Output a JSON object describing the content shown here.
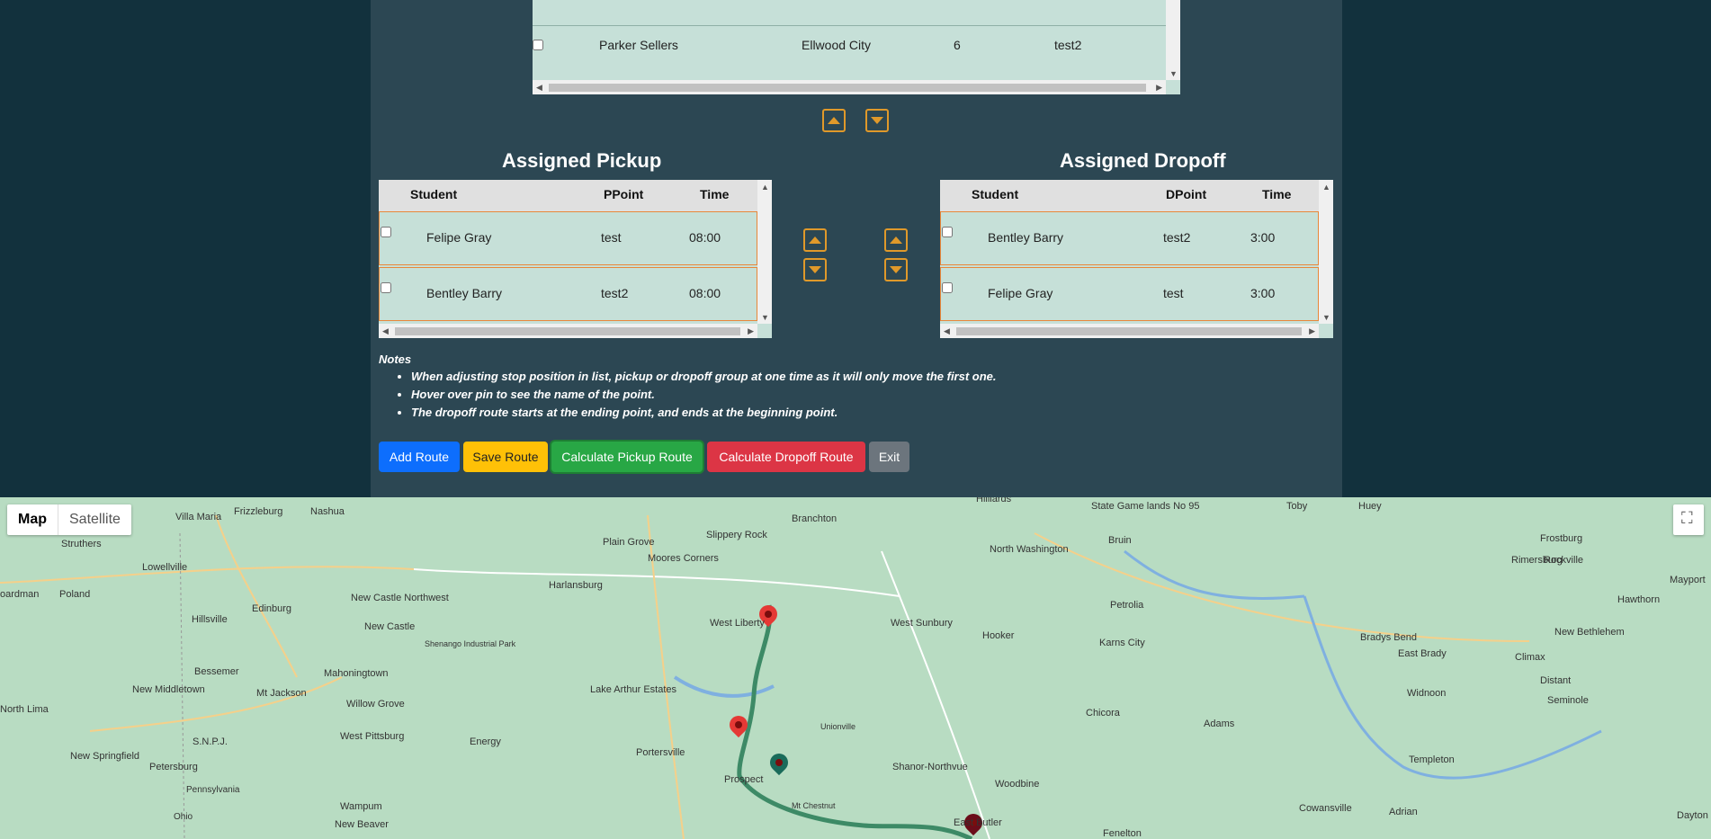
{
  "top_table": {
    "rows": [
      {
        "name": "Parker Sellers",
        "city": "Ellwood City",
        "num": "6",
        "point": "test2"
      }
    ]
  },
  "pickup": {
    "title": "Assigned Pickup",
    "headers": {
      "student": "Student",
      "point": "PPoint",
      "time": "Time"
    },
    "rows": [
      {
        "student": "Felipe Gray",
        "point": "test",
        "time": "08:00"
      },
      {
        "student": "Bentley Barry",
        "point": "test2",
        "time": "08:00"
      }
    ]
  },
  "dropoff": {
    "title": "Assigned Dropoff",
    "headers": {
      "student": "Student",
      "point": "DPoint",
      "time": "Time"
    },
    "rows": [
      {
        "student": "Bentley Barry",
        "point": "test2",
        "time": "3:00"
      },
      {
        "student": "Felipe Gray",
        "point": "test",
        "time": "3:00"
      }
    ]
  },
  "notes": {
    "title": "Notes",
    "items": [
      "When adjusting stop position in list, pickup or dropoff group at one time as it will only move the first one.",
      "Hover over pin to see the name of the point.",
      "The dropoff route starts at the ending point, and ends at the beginning point."
    ]
  },
  "buttons": {
    "add_route": "Add Route",
    "save_route": "Save Route",
    "calc_pickup": "Calculate Pickup Route",
    "calc_dropoff": "Calculate Dropoff Route",
    "exit": "Exit"
  },
  "colors": {
    "add": "#0d6efd",
    "save": "#ffc107",
    "pickup": "#28a745",
    "dropoff": "#dc3545",
    "exit": "#6c757d",
    "route": "#3d8a66",
    "pin_red": "#e53935",
    "pin_teal": "#1a6b5a",
    "pin_dark": "#6b0d1a"
  },
  "map": {
    "map_type": {
      "map": "Map",
      "satellite": "Satellite"
    },
    "places": [
      "Villa Maria",
      "Frizzleburg",
      "Nashua",
      "Slippery Rock",
      "Branchton",
      "Hilliards",
      "State Game lands No 95",
      "Toby",
      "Huey",
      "Struthers",
      "Plain Grove",
      "Moores Corners",
      "North Washington",
      "Bruin",
      "Frostburg",
      "Rimersburg",
      "Rockville",
      "Lowellville",
      "Harlansburg",
      "Mayport",
      "oardman",
      "Poland",
      "New Castle Northwest",
      "Hawthorn",
      "Hillsville",
      "Edinburg",
      "New Castle",
      "West Liberty",
      "West Sunbury",
      "Petrolia",
      "New Bethlehem",
      "Shenango Industrial Park",
      "Hooker",
      "Bradys Bend",
      "East Brady",
      "Karns City",
      "Bessemer",
      "Mahoningtown",
      "Climax",
      "New Middletown",
      "Mt Jackson",
      "Lake Arthur Estates",
      "Distant",
      "Willow Grove",
      "Unionville",
      "Chicora",
      "Widnoon",
      "North Lima",
      "Energy",
      "Seminole",
      "Adams",
      "S.N.P.J.",
      "West Pittsburg",
      "Portersville",
      "Shanor-Northvue",
      "Templeton",
      "New Springfield",
      "Petersburg",
      "Prospect",
      "Woodbine",
      "Wampum",
      "Mt Chestnut",
      "Cowansville",
      "Adrian",
      "New Beaver",
      "East Butler",
      "Fenelton",
      "Dayton",
      "Ohio",
      "Pennsylvania"
    ]
  }
}
